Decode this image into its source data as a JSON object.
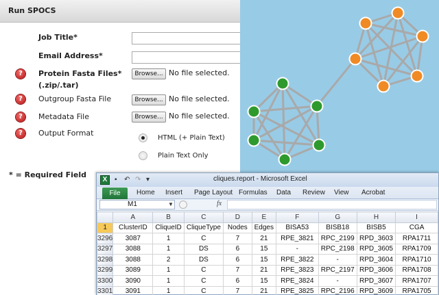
{
  "form": {
    "header_title": "Run SPOCS",
    "fields": {
      "job_title": "Job Title*",
      "email": "Email Address*",
      "protein_fasta_line1": "Protein Fasta Files*",
      "protein_fasta_line2": "(.zip/.tar)",
      "outgroup_fasta": "Outgroup Fasta File",
      "metadata": "Metadata File",
      "output_format": "Output Format"
    },
    "job_title_value": "",
    "email_value": "",
    "browse_label": "Browse...",
    "no_file_text": "No file selected.",
    "output_options": [
      "HTML (+ Plain Text)",
      "Plain Text Only"
    ],
    "output_selected": "HTML (+ Plain Text)",
    "help_icon_glyph": "?",
    "required_note": "* = Required Field"
  },
  "graph": {
    "background": "#98cbe6",
    "edge_color": "#a9a9a9",
    "green_node_color": "#2e9a2e",
    "orange_node_color": "#f08a24"
  },
  "excel": {
    "logo": "X",
    "undo_glyph": "↶",
    "redo_glyph": "↷",
    "save_glyph": "▪",
    "qa_dropdown": "▾",
    "title": "cliques.report  -  Microsoft Excel",
    "tabs": [
      "File",
      "Home",
      "Insert",
      "Page Layout",
      "Formulas",
      "Data",
      "Review",
      "View",
      "Acrobat"
    ],
    "name_box": "M1",
    "fx": "fx",
    "columns": [
      "A",
      "B",
      "C",
      "D",
      "E",
      "F",
      "G",
      "H",
      "I"
    ],
    "row_numbers": [
      "1",
      "3296",
      "3297",
      "3298",
      "3299",
      "3300",
      "3301"
    ],
    "rows": [
      [
        "ClusterID",
        "CliqueID",
        "CliqueType",
        "Nodes",
        "Edges",
        "BISA53",
        "BISB18",
        "BISB5",
        "CGA"
      ],
      [
        "3087",
        "1",
        "C",
        "7",
        "21",
        "RPE_3821",
        "RPC_2199",
        "RPD_3603",
        "RPA1711"
      ],
      [
        "3088",
        "1",
        "DS",
        "6",
        "15",
        "-",
        "RPC_2198",
        "RPD_3605",
        "RPA1709"
      ],
      [
        "3088",
        "2",
        "DS",
        "6",
        "15",
        "RPE_3822",
        "-",
        "RPD_3604",
        "RPA1710"
      ],
      [
        "3089",
        "1",
        "C",
        "7",
        "21",
        "RPE_3823",
        "RPC_2197",
        "RPD_3606",
        "RPA1708"
      ],
      [
        "3090",
        "1",
        "C",
        "6",
        "15",
        "RPE_3824",
        "-",
        "RPD_3607",
        "RPA1707"
      ],
      [
        "3091",
        "1",
        "C",
        "7",
        "21",
        "RPE_3825",
        "RPC_2196",
        "RPD_3609",
        "RPA1705"
      ]
    ]
  }
}
